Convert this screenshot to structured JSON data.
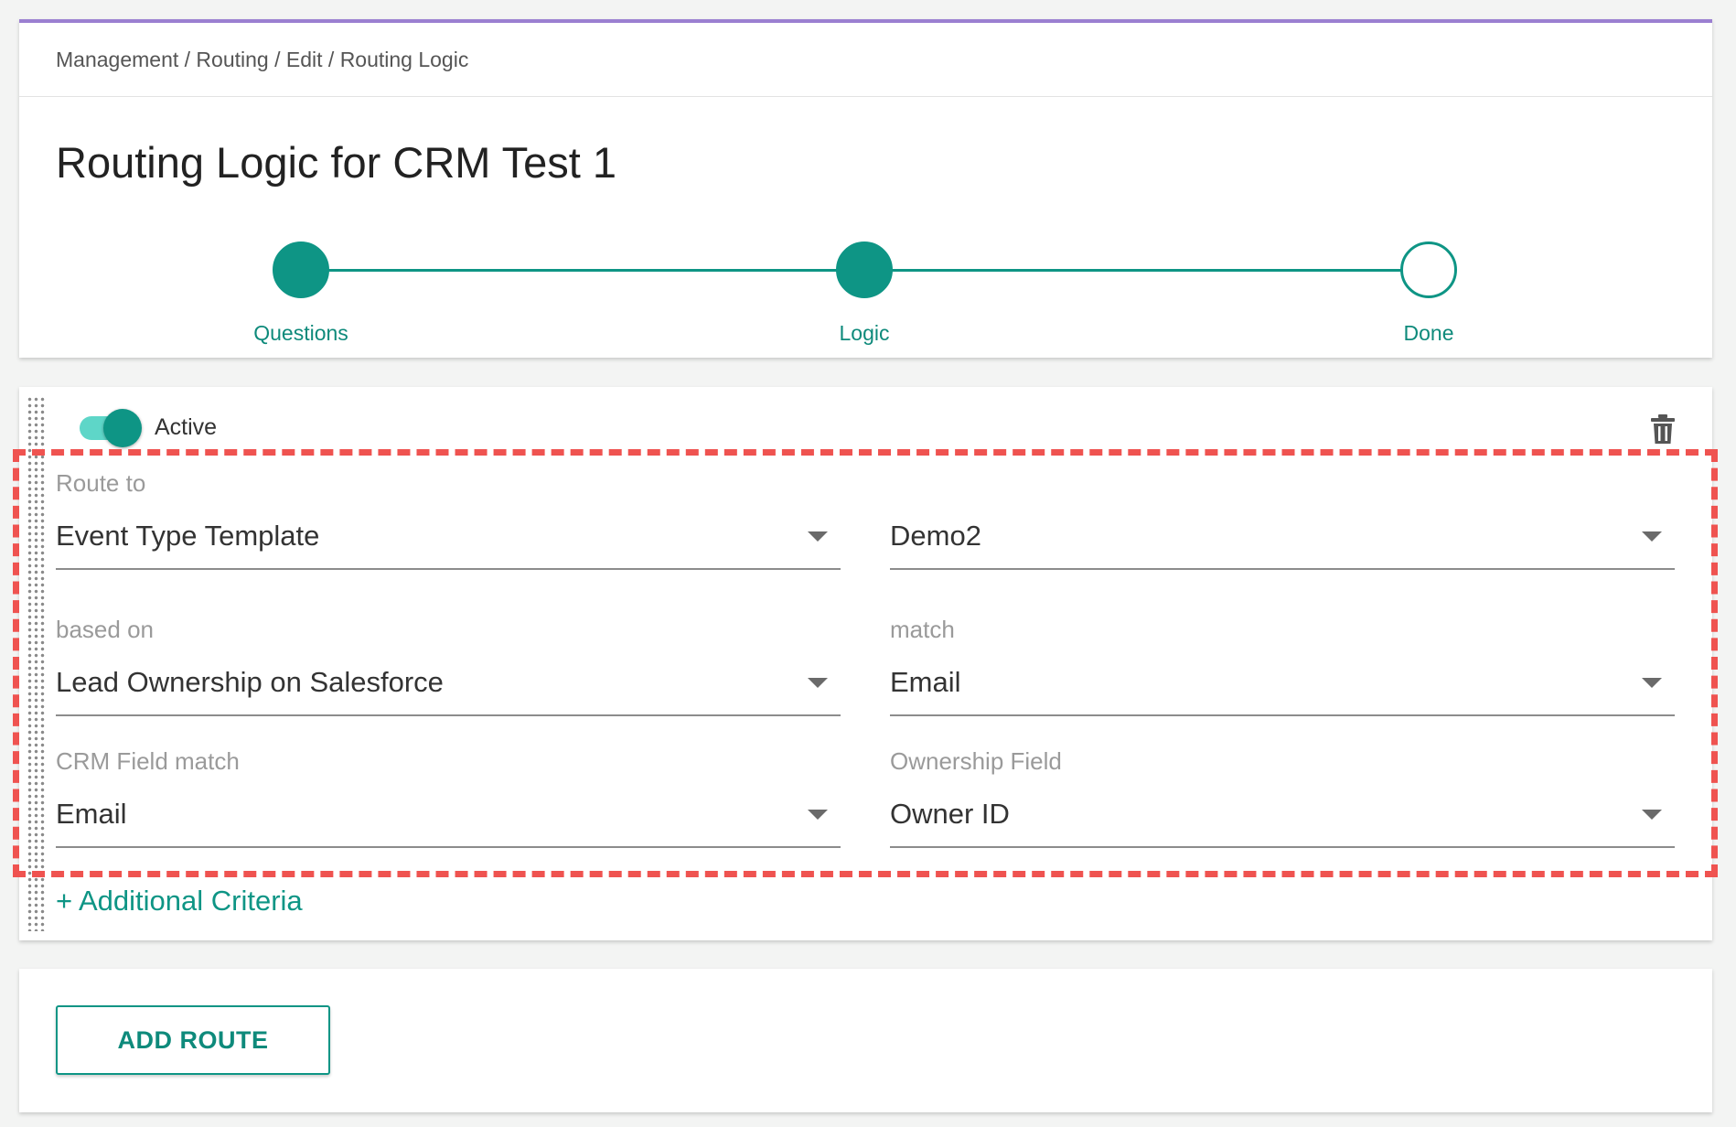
{
  "breadcrumb": {
    "items": [
      "Management",
      "Routing",
      "Edit",
      "Routing Logic"
    ],
    "separator": " / "
  },
  "page_title": "Routing Logic for CRM Test 1",
  "stepper": {
    "steps": [
      {
        "label": "Questions",
        "state": "complete"
      },
      {
        "label": "Logic",
        "state": "complete"
      },
      {
        "label": "Done",
        "state": "pending"
      }
    ],
    "accent_color": "#0e9585"
  },
  "route": {
    "active_label": "Active",
    "active": true,
    "fields": {
      "route_to": {
        "label": "Route to",
        "value": "Event Type Template"
      },
      "route_to_target": {
        "label": "",
        "value": "Demo2"
      },
      "based_on": {
        "label": "based on",
        "value": "Lead Ownership on Salesforce"
      },
      "match": {
        "label": "match",
        "value": "Email"
      },
      "crm_field_match": {
        "label": "CRM Field match",
        "value": "Email"
      },
      "ownership_field": {
        "label": "Ownership Field",
        "value": "Owner ID"
      }
    },
    "additional_criteria_label": "+ Additional Criteria",
    "icons": {
      "delete": "trash-icon",
      "drag": "drag-handle-icon",
      "dropdown": "caret-down-icon"
    }
  },
  "add_route_label": "ADD ROUTE",
  "colors": {
    "accent": "#0e9585",
    "header_border": "#9b7fd1",
    "highlight": "#ef5350"
  }
}
